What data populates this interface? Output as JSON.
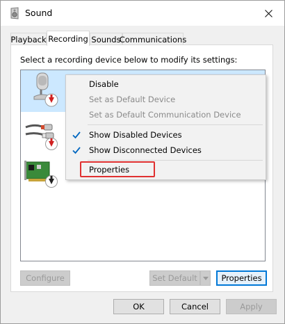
{
  "window": {
    "title": "Sound",
    "close_symbol": "✕"
  },
  "tabs": [
    {
      "label": "Playback"
    },
    {
      "label": "Recording"
    },
    {
      "label": "Sounds"
    },
    {
      "label": "Communications"
    }
  ],
  "active_tab": "Recording",
  "panel": {
    "instruction": "Select a recording device below to modify its settings:",
    "devices": [
      {
        "icon": "microphone-icon",
        "status_icon": "red-down-arrow-icon",
        "selected": true
      },
      {
        "icon": "rca-cable-icon",
        "status_icon": "red-down-arrow-icon",
        "selected": false
      },
      {
        "icon": "sound-card-icon",
        "status_icon": "black-down-arrow-icon",
        "selected": false
      }
    ],
    "buttons": {
      "configure": "Configure",
      "set_default": "Set Default",
      "properties": "Properties"
    }
  },
  "context_menu": {
    "items": [
      {
        "label": "Disable",
        "enabled": true,
        "checked": false
      },
      {
        "label": "Set as Default Device",
        "enabled": false,
        "checked": false
      },
      {
        "label": "Set as Default Communication Device",
        "enabled": false,
        "checked": false
      },
      {
        "label": "Show Disabled Devices",
        "enabled": true,
        "checked": true
      },
      {
        "label": "Show Disconnected Devices",
        "enabled": true,
        "checked": true
      },
      {
        "label": "Properties",
        "enabled": true,
        "checked": false,
        "highlighted": true
      }
    ]
  },
  "footer": {
    "ok": "OK",
    "cancel": "Cancel",
    "apply": "Apply"
  },
  "colors": {
    "selection": "#cce8ff",
    "accent": "#0078d7",
    "highlight_border": "#e03030",
    "check": "#0067c0"
  }
}
